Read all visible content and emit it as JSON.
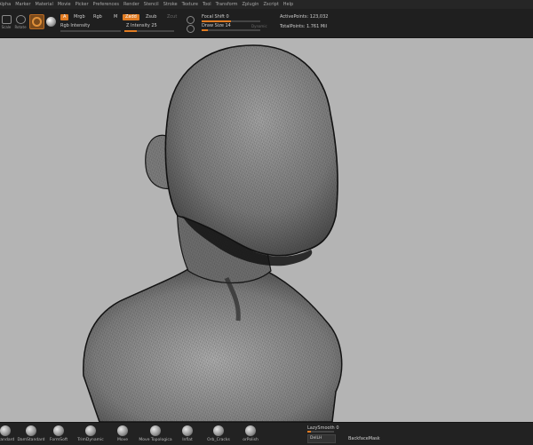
{
  "menubar": {
    "items": [
      "Alpha",
      "Marker",
      "Material",
      "Movie",
      "Picker",
      "Preferences",
      "Render",
      "Stencil",
      "Stroke",
      "Texture",
      "Tool",
      "Transform",
      "Zplugin",
      "Zscript",
      "Help"
    ]
  },
  "toolbar": {
    "scale_label": "Scale",
    "rotate_label": "Rotate",
    "a_label": "A",
    "mrgb_label": "Mrgb",
    "rgb_label": "Rgb",
    "m_label": "M",
    "rgb_intensity_label": "Rgb Intensity",
    "zadd_label": "Zadd",
    "zsub_label": "Zsub",
    "zcut_label": "Zcut",
    "z_intensity_label": "Z Intensity 25",
    "z_intensity_value": 25,
    "focal_shift_label": "Focal Shift 0",
    "draw_size_label": "Draw Size 14",
    "dynamic_label": "Dynamic",
    "active_points_label": "ActivePoints: 123,032",
    "total_points_label": "TotalPoints: 1.761 Mil",
    "accent_color": "#e07b22"
  },
  "shelf": {
    "brushes": [
      "Standard",
      "DamStandard",
      "FormSoft",
      "TrimDynamic",
      "Move",
      "Move Topologica",
      "Inflat",
      "Orb_Cracks",
      "orPolish"
    ],
    "lazy_smooth_label": "LazySmooth 0",
    "del_hidden_label": "DelLH",
    "backface_label": "BackfaceMask"
  },
  "viewport": {
    "background_color": "#b4b4b4",
    "model_color": "#8a8a8a"
  }
}
